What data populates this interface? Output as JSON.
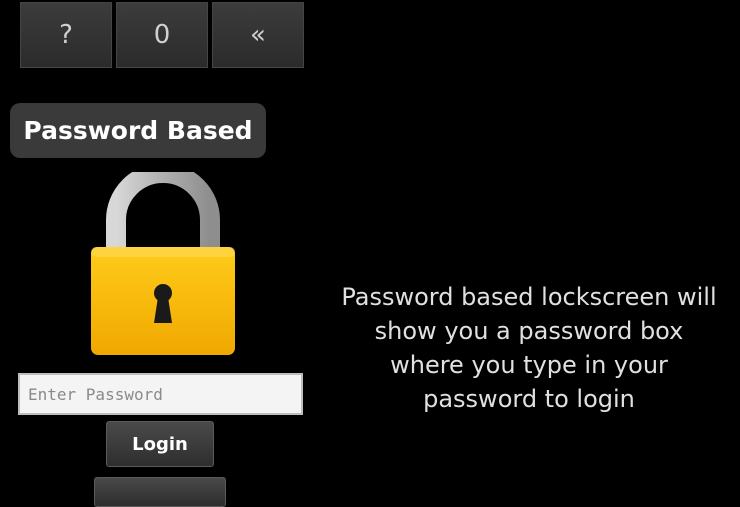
{
  "keypad": {
    "keys": [
      {
        "label": "?"
      },
      {
        "label": "0"
      },
      {
        "label": "«"
      }
    ]
  },
  "lock_mode": {
    "title": "Password Based",
    "icon": "padlock-icon",
    "colors": {
      "shackle": "#b7b7b7",
      "body": "#f5b800",
      "keyhole": "#1a1a1a"
    }
  },
  "password_field": {
    "placeholder": "Enter Password",
    "value": ""
  },
  "buttons": {
    "login_label": "Login"
  },
  "description": {
    "lines": [
      "Password based lockscreen will",
      "show you a password box",
      "where you type in your",
      "password to login"
    ]
  }
}
